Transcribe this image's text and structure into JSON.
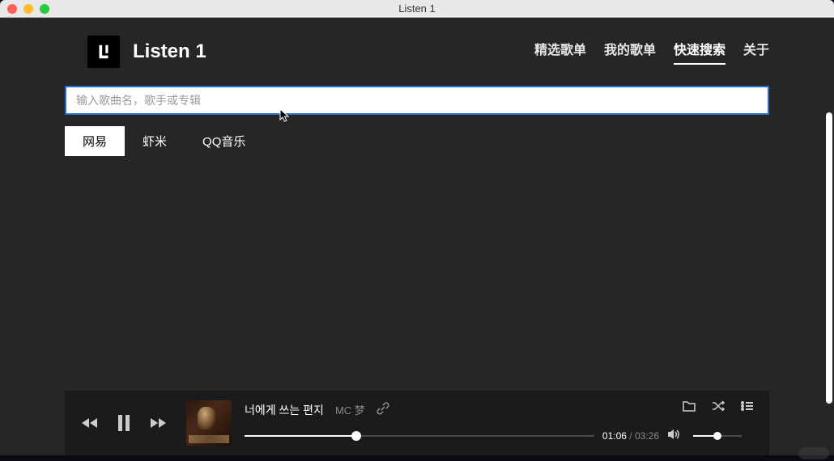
{
  "window": {
    "title": "Listen 1"
  },
  "brand": {
    "name": "Listen 1"
  },
  "nav": {
    "items": [
      {
        "label": "精选歌单",
        "active": false
      },
      {
        "label": "我的歌单",
        "active": false
      },
      {
        "label": "快速搜索",
        "active": true
      },
      {
        "label": "关于",
        "active": false
      }
    ]
  },
  "search": {
    "placeholder": "输入歌曲名，歌手或专辑",
    "value": ""
  },
  "source_tabs": [
    {
      "label": "网易",
      "active": true
    },
    {
      "label": "虾米",
      "active": false
    },
    {
      "label": "QQ音乐",
      "active": false
    }
  ],
  "player": {
    "track_title": "너에게 쓰는 편지",
    "artist": "MC 梦",
    "elapsed": "01:06",
    "duration": "03:26",
    "progress_percent": 32,
    "volume_percent": 50
  }
}
